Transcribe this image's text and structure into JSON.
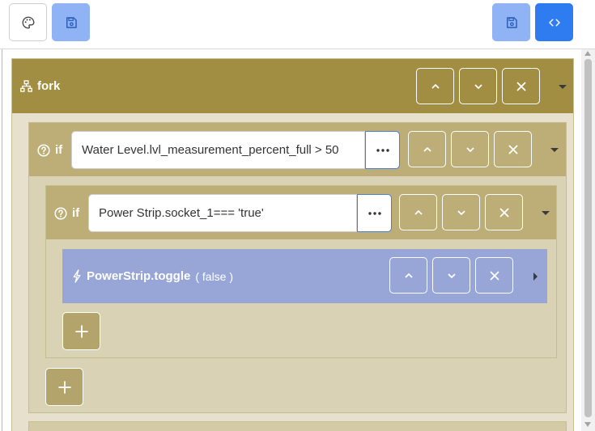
{
  "toolbar": {
    "left_buttons": [
      {
        "icon": "palette-icon"
      },
      {
        "icon": "save-icon"
      }
    ],
    "right_buttons": [
      {
        "icon": "save-icon"
      },
      {
        "icon": "code-icon"
      }
    ]
  },
  "fork": {
    "icon": "sitemap-icon",
    "label": "fork",
    "color": "#a28e42"
  },
  "if_outer": {
    "icon": "question-circle-icon",
    "label": "if",
    "condition": "Water Level.lvl_measurement_percent_full > 50",
    "color": "#bcae76"
  },
  "if_inner": {
    "icon": "question-circle-icon",
    "label": "if",
    "condition": "Power Strip.socket_1=== 'true'",
    "color": "#bcae76"
  },
  "action": {
    "icon": "bolt-icon",
    "name": "PowerStrip.toggle",
    "args": "( false )",
    "color": "#97a6d6"
  },
  "colors": {
    "toolbar_light_blue": "#8fb3f5",
    "toolbar_blue": "#2f7bf0",
    "fork_body": "#e6e0cc",
    "if_body": "#d9d2b5"
  }
}
